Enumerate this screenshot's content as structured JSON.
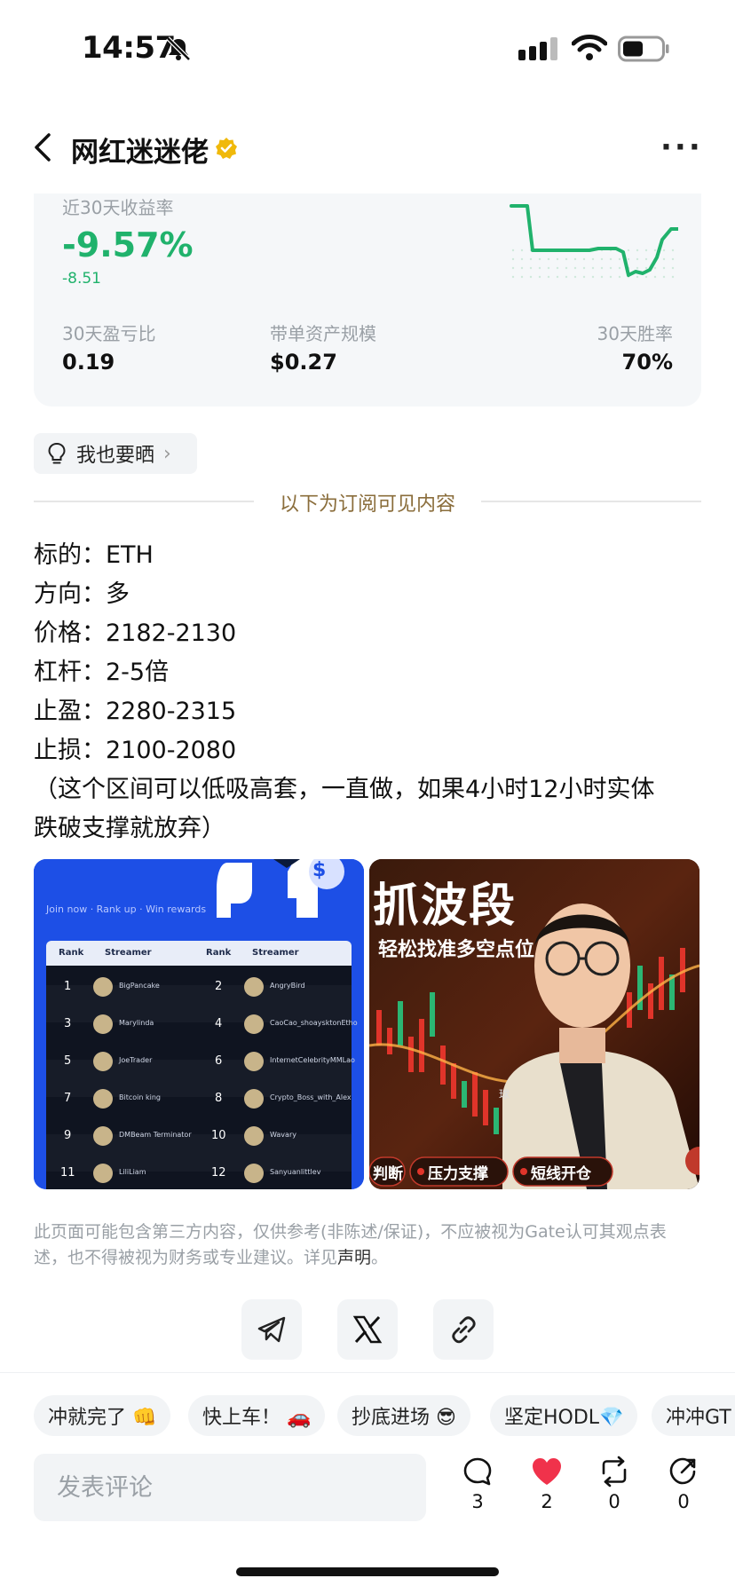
{
  "status_bar": {
    "time": "14:57"
  },
  "nav": {
    "title": "网红迷迷佬",
    "more": "···"
  },
  "stats": {
    "roi_label": "近30天收益率",
    "roi_value": "-9.57%",
    "roi_sub": "-8.51",
    "metrics": [
      {
        "label": "30天盈亏比",
        "value": "0.19"
      },
      {
        "label": "带单资产规模",
        "value": "$0.27"
      },
      {
        "label": "30天胜率",
        "value": "70%"
      }
    ],
    "colors": {
      "positive": "#20b26c"
    }
  },
  "share_pill": {
    "label": "我也要晒",
    "chevron": "›"
  },
  "divider": {
    "text": "以下为订阅可见内容"
  },
  "post": {
    "lines": [
      "标的：ETH",
      "方向：多",
      "价格：2182-2130",
      "杠杆：2-5倍",
      "止盈：2280-2315",
      "止损：2100-2080",
      "（这个区间可以低吸高套，一直做，如果4小时12小时实体",
      "跌破支撑就放弃）"
    ]
  },
  "image_left": {
    "banner": "Join now · Rank up · Win rewards",
    "col_rank": "Rank",
    "col_streamer": "Streamer",
    "rows": [
      {
        "r1": "1",
        "n1": "BigPancake",
        "r2": "2",
        "n2": "AngryBird"
      },
      {
        "r1": "3",
        "n1": "Marylinda",
        "r2": "4",
        "n2": "CaoCao_shoaysktonEtho"
      },
      {
        "r1": "5",
        "n1": "JoeTrader",
        "r2": "6",
        "n2": "InternetCelebrityMMLao"
      },
      {
        "r1": "7",
        "n1": "Bitcoin king",
        "r2": "8",
        "n2": "Crypto_Boss_with_Alex"
      },
      {
        "r1": "9",
        "n1": "DMBeam Terminator",
        "r2": "10",
        "n2": "Wavary"
      },
      {
        "r1": "11",
        "n1": "LiliLiam",
        "r2": "12",
        "n2": "Sanyuanlittlev"
      }
    ],
    "dollar": "$"
  },
  "image_right": {
    "headline": "抓波段",
    "subline": "轻松找准多空点位",
    "tags": [
      "判断",
      "压力支撑",
      "短线开仓"
    ],
    "jacket_text": "球"
  },
  "disclaimer": {
    "text": "此页面可能包含第三方内容，仅供参考(非陈述/保证)，不应被视为Gate认可其观点表述，也不得被视为财务或专业建议。详见",
    "link": "声明",
    "end": "。"
  },
  "quick_replies": [
    "冲就完了 👊",
    "快上车！ 🚗",
    "抄底进场 😎",
    "坚定HODL💎",
    "冲冲GT"
  ],
  "comment": {
    "placeholder": "发表评论"
  },
  "actions": [
    {
      "icon": "comment-icon",
      "count": "3"
    },
    {
      "icon": "heart-icon",
      "count": "2"
    },
    {
      "icon": "repost-icon",
      "count": "0"
    },
    {
      "icon": "forward-icon",
      "count": "0"
    }
  ]
}
